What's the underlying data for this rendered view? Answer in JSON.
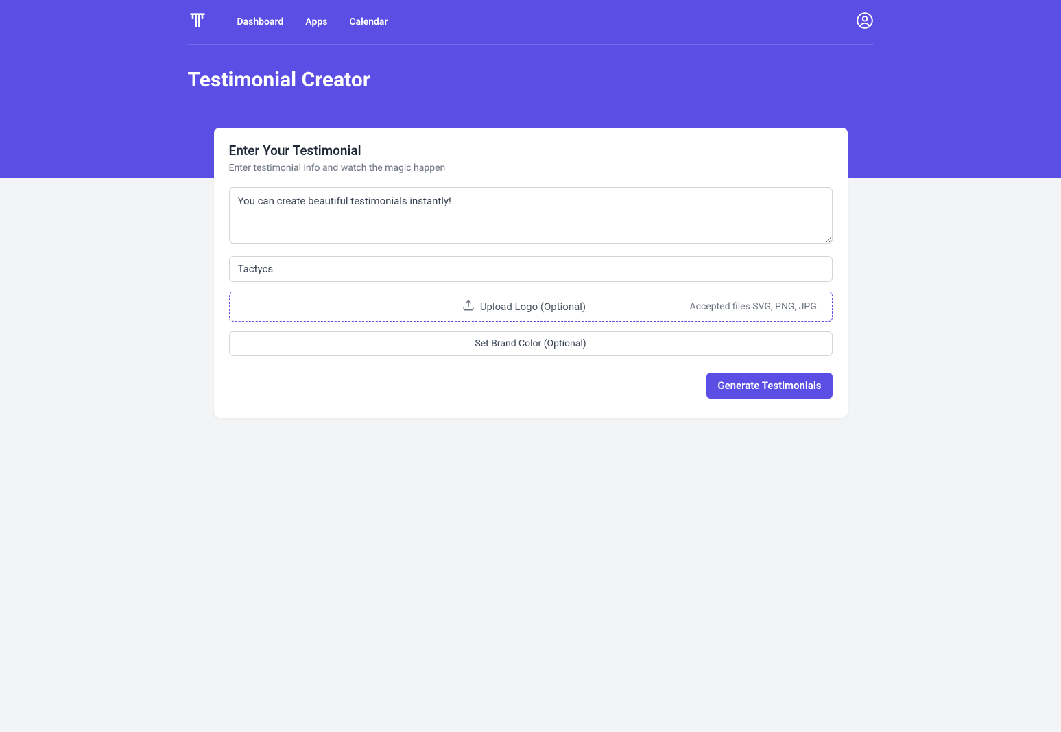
{
  "nav": {
    "links": [
      "Dashboard",
      "Apps",
      "Calendar"
    ]
  },
  "page": {
    "title": "Testimonial Creator"
  },
  "card": {
    "title": "Enter Your Testimonial",
    "subtitle": "Enter testimonial info and watch the magic happen",
    "testimonial_value": "You can create beautiful testimonials instantly!",
    "company_value": "Tactycs",
    "upload_label": "Upload Logo (Optional)",
    "upload_hint": "Accepted files SVG, PNG, JPG.",
    "brand_color_label": "Set Brand Color (Optional)",
    "generate_label": "Generate Testimonials"
  }
}
